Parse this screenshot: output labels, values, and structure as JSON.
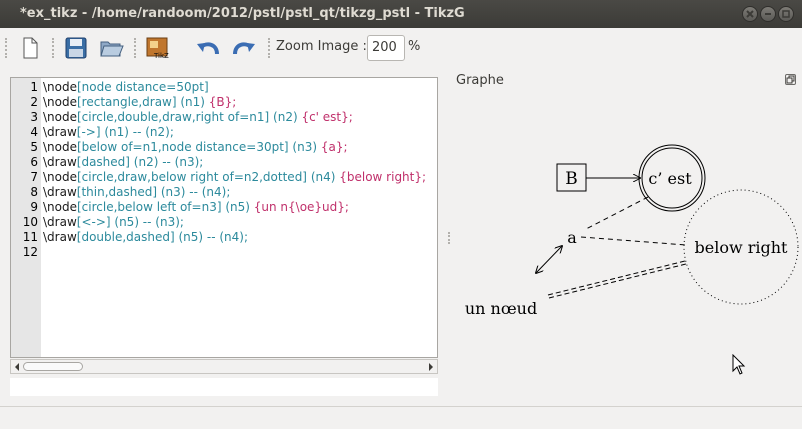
{
  "window": {
    "title": "*ex_tikz - /home/randoom/2012/pstl/pstl_qt/tikzg_pstl - TikzG"
  },
  "toolbar": {
    "buttons": [
      "new-file",
      "save",
      "open",
      "tikz-compile",
      "undo",
      "redo"
    ],
    "zoom_label": "Zoom Image :",
    "zoom_value": "200",
    "zoom_unit": "%"
  },
  "editor": {
    "line_numbers": [
      "1",
      "2",
      "3",
      "4",
      "5",
      "6",
      "7",
      "8",
      "9",
      "10",
      "11",
      "12"
    ],
    "lines": [
      [
        "\\node",
        "[node distance=50pt]",
        ""
      ],
      [
        "\\node",
        "[rectangle,draw]",
        " (n1) ",
        "{B};"
      ],
      [
        "\\node",
        "[circle,double,draw,right of=n1]",
        " (n2) ",
        "{c' est};"
      ],
      [
        "\\draw",
        "[->]",
        " (n1) -- (n2);",
        ""
      ],
      [
        "\\node",
        "[below of=n1,node distance=30pt]",
        " (n3) ",
        "{a};"
      ],
      [
        "\\draw",
        "[dashed]",
        " (n2) -- (n3);",
        ""
      ],
      [
        "\\node",
        "[circle,draw,below right of=n2,dotted]",
        " (n4) ",
        "{below right};"
      ],
      [
        "\\draw",
        "[thin,dashed]",
        " (n3) -- (n4);",
        ""
      ],
      [
        "\\node",
        "[circle,below left of=n3]",
        " (n5) ",
        "{un n{\\oe}ud};"
      ],
      [
        "\\draw",
        "[<->]",
        " (n5) -- (n3);",
        ""
      ],
      [
        "\\draw",
        "[double,dashed]",
        " (n5) -- (n4);",
        ""
      ],
      [
        "",
        "",
        "",
        ""
      ]
    ]
  },
  "graph_panel": {
    "title": "Graphe",
    "nodes": {
      "n1": "B",
      "n2": "c’ est",
      "n3": "a",
      "n4": "below right",
      "n5": "un nœud"
    }
  }
}
